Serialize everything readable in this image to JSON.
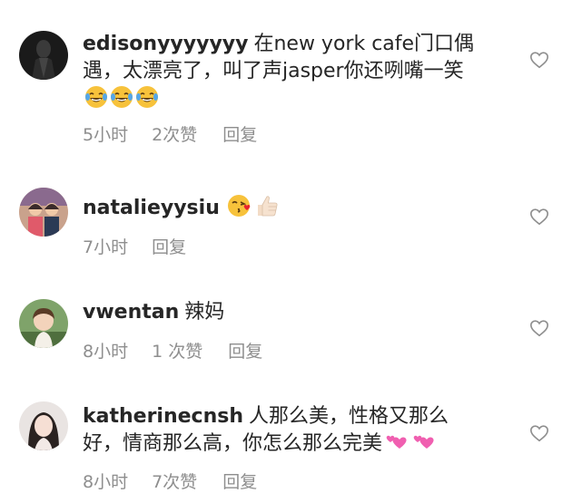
{
  "comments": [
    {
      "username": "edisonyyyyyyy",
      "text": "在new york cafe门口偶遇，太漂亮了，叫了声jasper你还咧嘴一笑",
      "emojis": [
        "laughing-tears-emoji",
        "laughing-tears-emoji",
        "laughing-tears-emoji"
      ],
      "time": "5小时",
      "likes": "2次赞",
      "reply": "回复"
    },
    {
      "username": "natalieyysiu",
      "text": "",
      "emojis": [
        "kissing-heart-emoji",
        "thumbs-up-emoji"
      ],
      "time": "7小时",
      "likes": "",
      "reply": "回复"
    },
    {
      "username": "vwentan",
      "text": "辣妈",
      "emojis": [],
      "time": "8小时",
      "likes": "1 次赞",
      "reply": "回复"
    },
    {
      "username": "katherinecnsh",
      "text": "人那么美，性格又那么好，情商那么高，你怎么那么完美",
      "emojis": [
        "two-hearts-emoji",
        "two-hearts-emoji"
      ],
      "time": "8小时",
      "likes": "7次赞",
      "reply": "回复"
    }
  ],
  "colors": {
    "text": "#262626",
    "meta": "#8e8e8e",
    "heart_outline": "#8e8e8e"
  }
}
